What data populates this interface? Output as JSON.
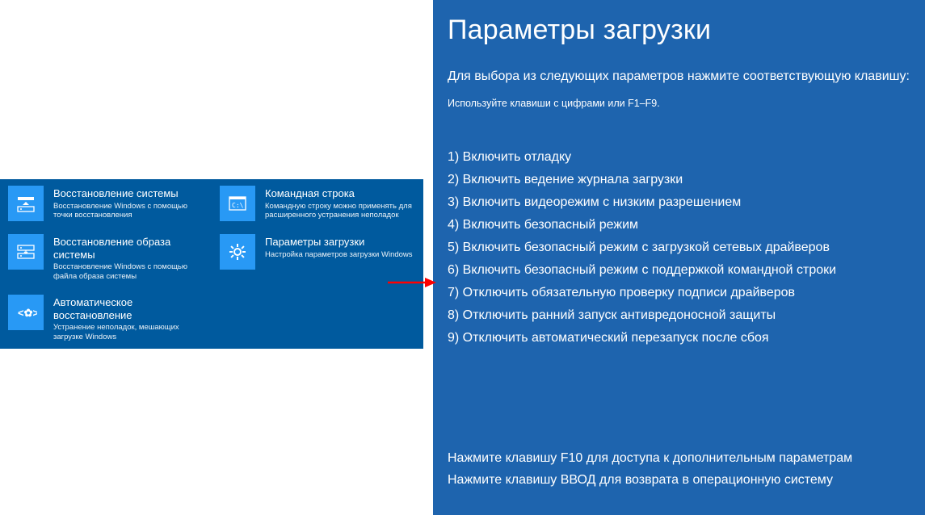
{
  "left": {
    "tiles": [
      {
        "title": "Восстановление системы",
        "desc": "Восстановление Windows с помощью точки восстановления"
      },
      {
        "title": "Командная строка",
        "desc": "Командную строку можно применять для расширенного устранения неполадок"
      },
      {
        "title": "Восстановление образа системы",
        "desc": "Восстановление Windows с помощью файла образа системы"
      },
      {
        "title": "Параметры загрузки",
        "desc": "Настройка параметров загрузки Windows"
      },
      {
        "title": "Автоматическое восстановление",
        "desc": "Устранение неполадок, мешающих загрузке Windows"
      }
    ]
  },
  "right": {
    "title": "Параметры загрузки",
    "subtitle": "Для выбора из следующих параметров нажмите соответствующую клавишу:",
    "hint": "Используйте клавиши с цифрами или F1–F9.",
    "options": [
      "1) Включить отладку",
      "2) Включить ведение журнала загрузки",
      "3) Включить видеорежим с низким разрешением",
      "4) Включить безопасный режим",
      "5) Включить безопасный режим с загрузкой сетевых драйверов",
      "6) Включить безопасный режим с поддержкой командной строки",
      "7) Отключить обязательную проверку подписи драйверов",
      "8) Отключить ранний запуск антивредоносной защиты",
      "9) Отключить автоматический перезапуск после сбоя"
    ],
    "footer1": "Нажмите клавишу F10 для доступа к дополнительным параметрам",
    "footer2": "Нажмите клавишу ВВОД для возврата в операционную систему"
  }
}
